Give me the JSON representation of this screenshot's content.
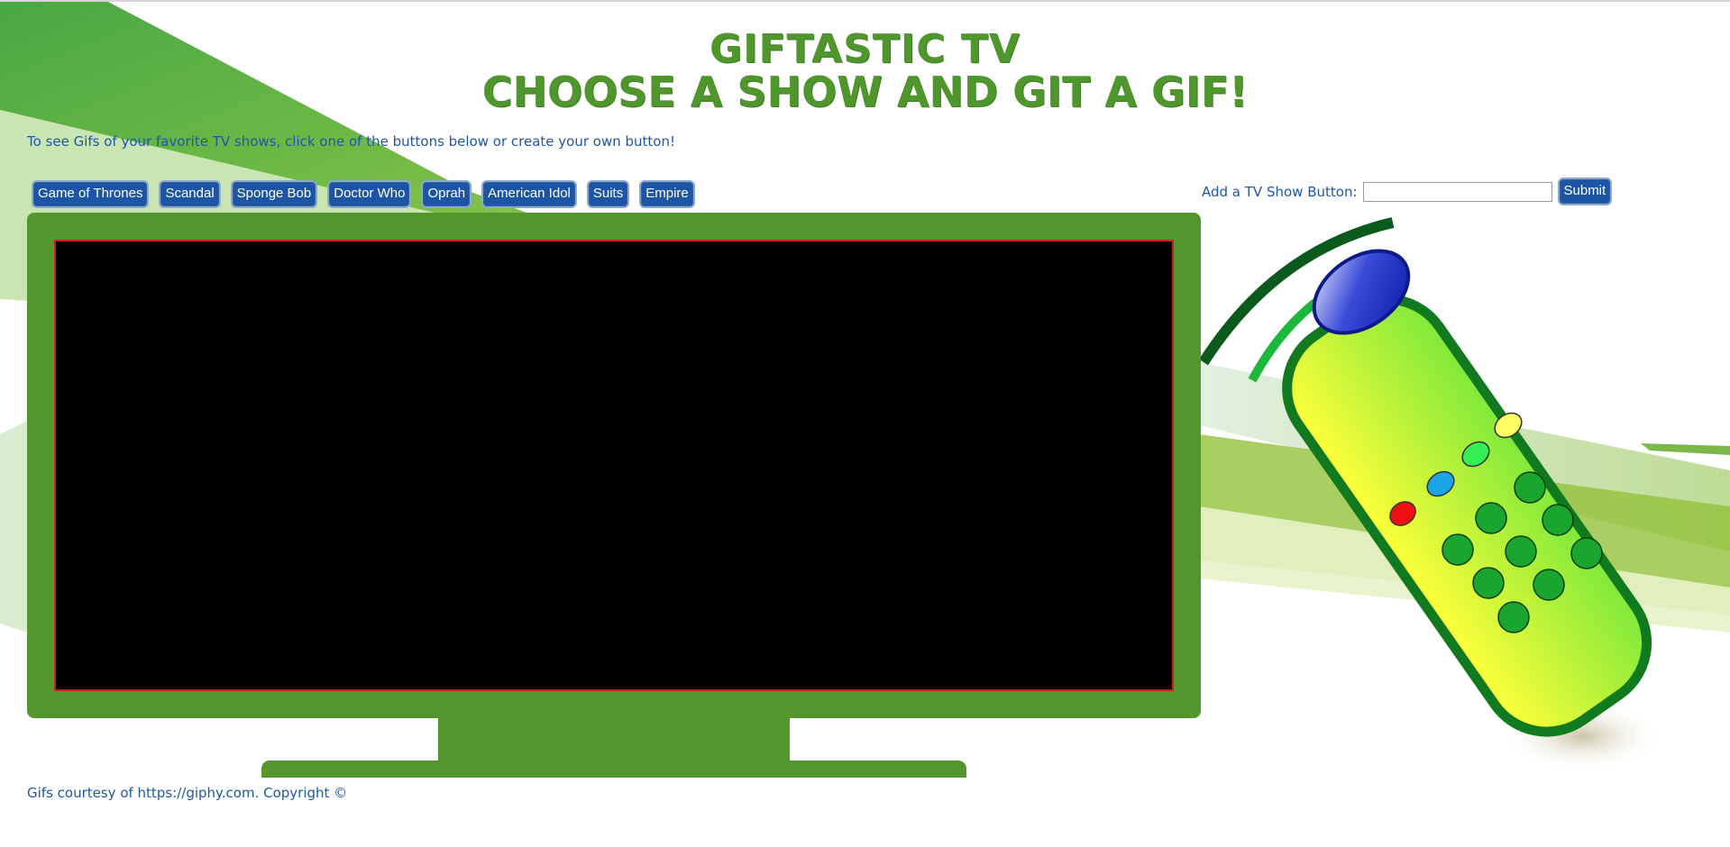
{
  "header": {
    "title_line1": "Giftastic TV",
    "title_line2": "Choose a Show and Git a Gif!"
  },
  "intro_text": "To see Gifs of your favorite TV shows, click one of the buttons below or create your own button!",
  "show_buttons": [
    "Game of Thrones",
    "Scandal",
    "Sponge Bob",
    "Doctor Who",
    "Oprah",
    "American Idol",
    "Suits",
    "Empire"
  ],
  "add_form": {
    "label": "Add a TV Show Button:",
    "input_value": "",
    "submit_label": "Submit"
  },
  "footer_text": "Gifs courtesy of https://giphy.com. Copyright ©",
  "colors": {
    "title": "#4f962d",
    "text": "#1f57a8",
    "button": "#1c55a6",
    "tv": "#52962d",
    "screen": "#000000"
  }
}
